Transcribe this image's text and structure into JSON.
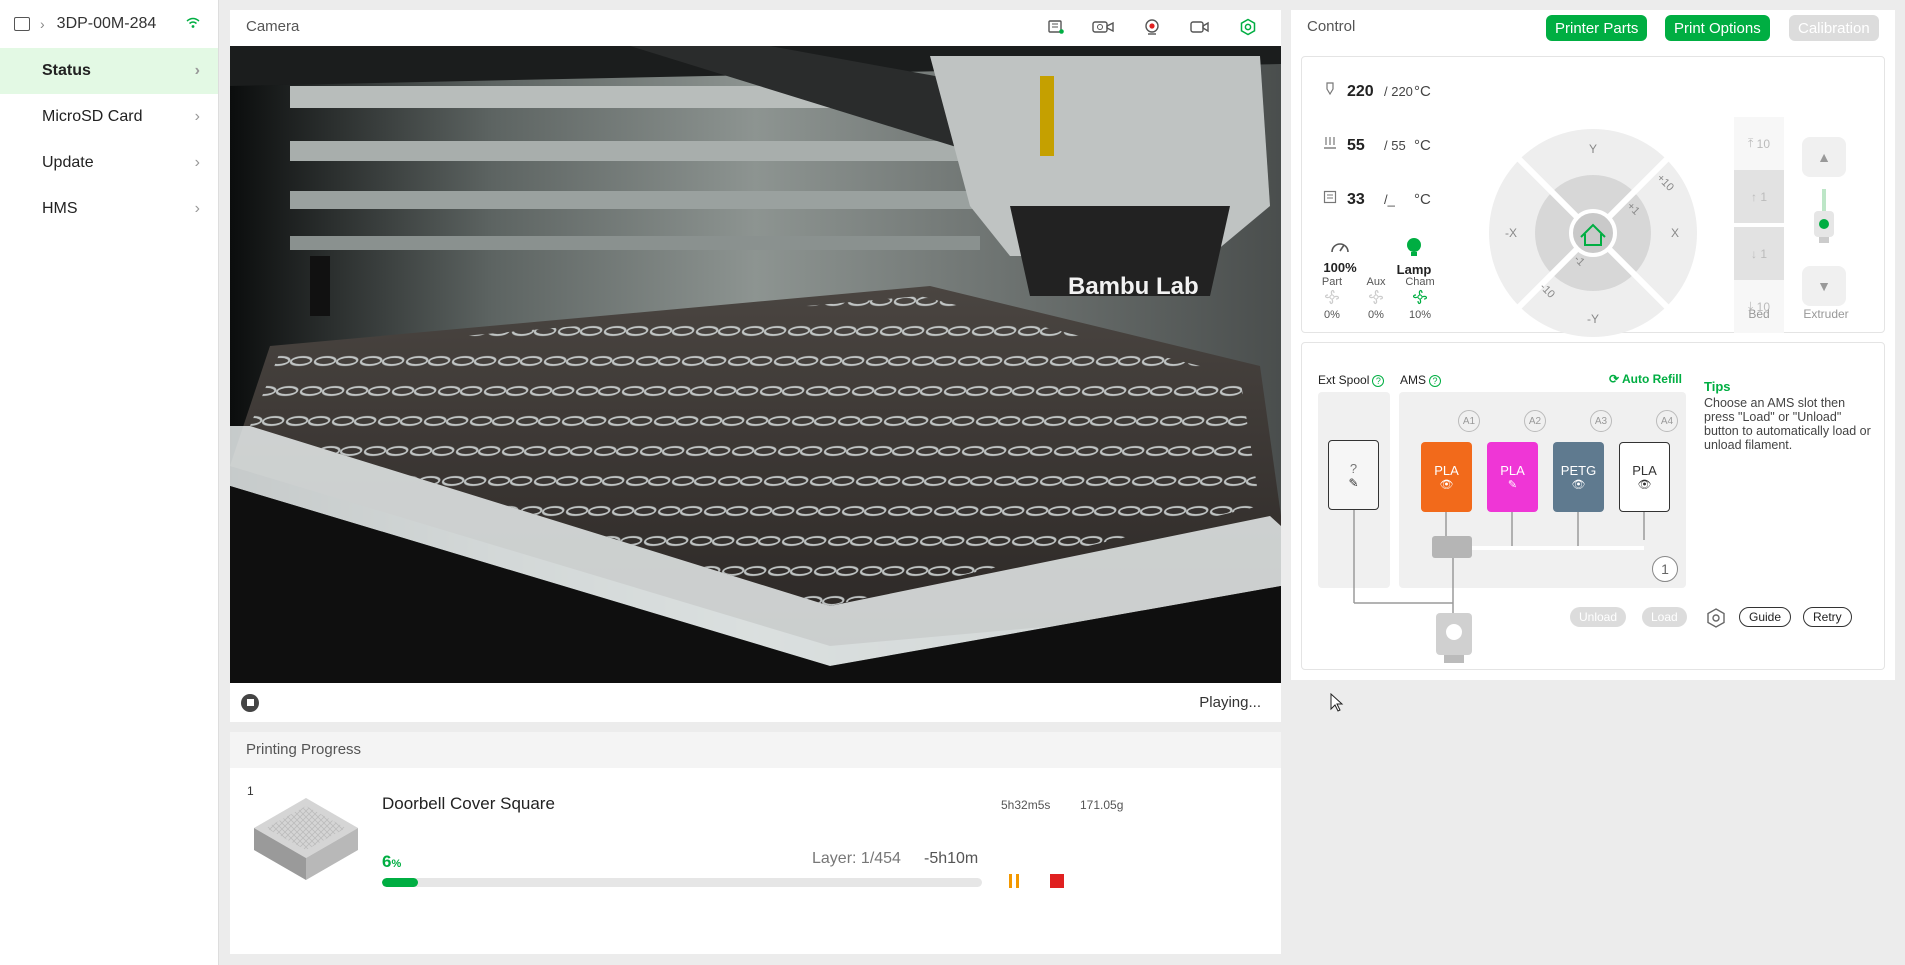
{
  "device": {
    "name": "3DP-00M-284",
    "icon": "printer-icon",
    "wifi_icon": "wifi-icon"
  },
  "sidebar": {
    "items": [
      {
        "label": "Status",
        "active": true
      },
      {
        "label": "MicroSD Card",
        "active": false
      },
      {
        "label": "Update",
        "active": false
      },
      {
        "label": "HMS",
        "active": false
      }
    ]
  },
  "camera": {
    "title": "Camera",
    "toolbar_icons": [
      "sd-card-icon",
      "video-timelapse-icon",
      "webcam-icon",
      "record-icon",
      "camera-settings-icon"
    ],
    "status": "Playing...",
    "logo_text": "Bambu Lab"
  },
  "progress": {
    "title": "Printing Progress",
    "plate": "1",
    "job_name": "Doorbell Cover Square",
    "total_time": "5h32m5s",
    "weight": "171.05g",
    "percent": "6",
    "percent_unit": "%",
    "percent_value": 0.06,
    "layer": "Layer: 1/454",
    "remaining": "-5h10m"
  },
  "control": {
    "title": "Control",
    "buttons": {
      "printer_parts": "Printer Parts",
      "print_options": "Print Options",
      "calibration": "Calibration"
    },
    "nozzle": {
      "current": "220",
      "target": "/ 220",
      "unit": "°C"
    },
    "bed": {
      "current": "55",
      "target": "/ 55",
      "unit": "°C"
    },
    "chamber": {
      "current": "33",
      "target": "/_",
      "unit": "°C"
    },
    "speed": {
      "value": "100%"
    },
    "lamp": {
      "label": "Lamp"
    },
    "fans": [
      {
        "label": "Part",
        "value": "0%"
      },
      {
        "label": "Aux",
        "value": "0%"
      },
      {
        "label": "Cham",
        "value": "10%"
      }
    ],
    "jog": {
      "y": "Y",
      "neg_y": "-Y",
      "x": "X",
      "neg_x": "-X",
      "p10": "+10",
      "p1": "+1",
      "m1": "-1",
      "m10": "-10"
    },
    "bed_moves": [
      "10",
      "1",
      "1",
      "10"
    ],
    "bed_label": "Bed",
    "extruder_label": "Extruder"
  },
  "ams": {
    "ext_spool_label": "Ext Spool",
    "ams_label": "AMS",
    "auto_refill": "Auto Refill",
    "ext_spool_value": "?",
    "slots": [
      {
        "tag": "A1",
        "material": "PLA",
        "color": "#f26a1b",
        "text_color": "#ffffff"
      },
      {
        "tag": "A2",
        "material": "PLA",
        "color": "#ef36d6",
        "text_color": "#ffffff"
      },
      {
        "tag": "A3",
        "material": "PETG",
        "color": "#5f7a8f",
        "text_color": "#ffffff"
      },
      {
        "tag": "A4",
        "material": "PLA",
        "color": "#ffffff",
        "text_color": "#333333"
      }
    ],
    "unit_number": "1",
    "buttons": {
      "unload": "Unload",
      "load": "Load",
      "guide": "Guide",
      "retry": "Retry"
    },
    "tips_title": "Tips",
    "tips_text": "Choose an AMS slot then press \"Load\" or \"Unload\" button to automatically load or unload filament."
  }
}
